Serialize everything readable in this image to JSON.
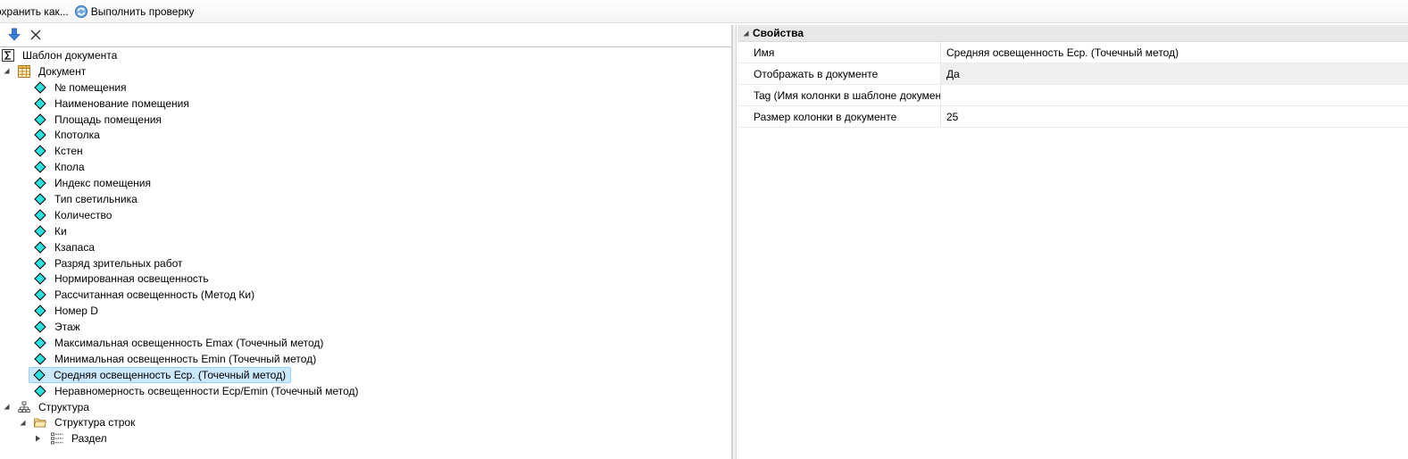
{
  "toolbar": {
    "save_as_label": "охранить как...",
    "check_label": "Выполнить проверку"
  },
  "tree": {
    "root_label": "Шаблон документа",
    "document_label": "Документ",
    "columns": [
      "№ помещения",
      "Наименование помещения",
      "Площадь помещения",
      "Кпотолка",
      "Кстен",
      "Кпола",
      "Индекс помещения",
      "Тип светильника",
      "Количество",
      "Ки",
      "Кзапаса",
      "Разряд зрительных работ",
      "Нормированная освещенность",
      "Рассчитанная освещенность (Метод Ки)",
      "Номер D",
      "Этаж",
      "Максимальная освещенность Emax (Точечный метод)",
      "Минимальная освещенность Emin (Точечный метод)",
      "Средняя освещенность Еср. (Точечный метод)",
      "Неравномерность освещенности Еср/Emin (Точечный метод)"
    ],
    "selected_index": 18,
    "structure_label": "Структура",
    "rows_structure_label": "Структура строк",
    "section_label": "Раздел"
  },
  "properties": {
    "category": "Свойства",
    "rows": [
      {
        "name": "Имя",
        "value": "Средняя освещенность Еср. (Точечный метод)"
      },
      {
        "name": "Отображать в документе",
        "value": "Да"
      },
      {
        "name": "Tag (Имя колонки в шаблоне документа)",
        "value": ""
      },
      {
        "name": "Размер колонки в документе",
        "value": "25"
      }
    ]
  },
  "colors": {
    "selection_bg": "#cce8ff",
    "selection_border": "#99d1ff",
    "diamond_fill": "#2fe0e0",
    "category_bg": "#e8e8e8"
  }
}
